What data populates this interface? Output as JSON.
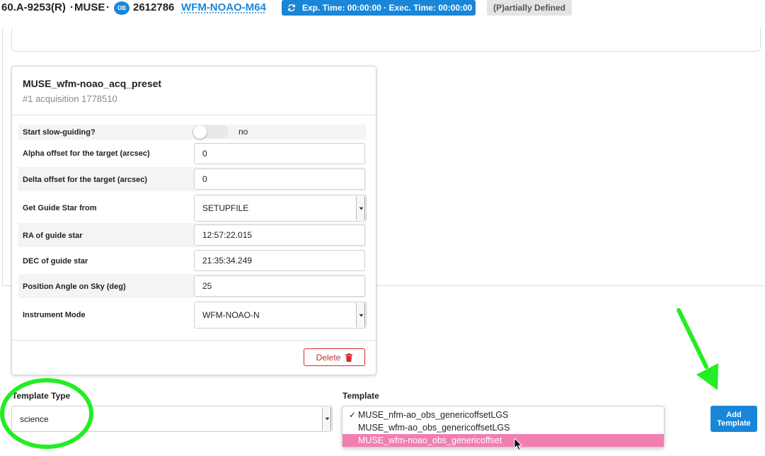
{
  "header": {
    "program": "60.A-9253(R)",
    "sep1": "·",
    "instrument": "MUSE",
    "sep2": "·",
    "ob_badge": "OB",
    "ob_id": "2612786",
    "ob_name": "WFM-NOAO-M64",
    "exposure_info": "Exp. Time: 00:00:00 · Exec. Time: 00:00:00",
    "status": "(P)artially Defined"
  },
  "template_card": {
    "title": "MUSE_wfm-noao_acq_preset",
    "subtitle": "#1 acquisition 1778510",
    "params": {
      "slow_guiding": {
        "label": "Start slow-guiding?",
        "value": "no",
        "enabled": false
      },
      "alpha_offset": {
        "label": "Alpha offset for the target (arcsec)",
        "value": "0"
      },
      "delta_offset": {
        "label": "Delta offset for the target (arcsec)",
        "value": "0"
      },
      "guide_star_from": {
        "label": "Get Guide Star from",
        "value": "SETUPFILE"
      },
      "ra_guide": {
        "label": "RA of guide star",
        "value": "12:57:22.015"
      },
      "dec_guide": {
        "label": "DEC of guide star",
        "value": "21:35:34.249"
      },
      "position_angle": {
        "label": "Position Angle on Sky (deg)",
        "value": "25"
      },
      "instrument_mode": {
        "label": "Instrument Mode",
        "value": "WFM-NOAO-N"
      }
    },
    "delete_label": "Delete"
  },
  "template_type": {
    "label": "Template Type",
    "value": "science"
  },
  "template": {
    "label": "Template",
    "options": [
      {
        "label": "MUSE_nfm-ao_obs_genericoffsetLGS",
        "checked": true,
        "highlighted": false
      },
      {
        "label": "MUSE_wfm-ao_obs_genericoffsetLGS",
        "checked": false,
        "highlighted": false
      },
      {
        "label": "MUSE_wfm-noao_obs_genericoffset",
        "checked": false,
        "highlighted": true
      }
    ],
    "check_mark": "✓"
  },
  "add_template": {
    "line1": "Add",
    "line2": "Template"
  },
  "colors": {
    "accent": "#1a86d8",
    "danger": "#d9262e",
    "highlight": "#f07fb0",
    "annotation": "#22ee22"
  },
  "icons": {
    "refresh": "refresh-icon",
    "trash": "trash-icon",
    "dropdown": "caret-down-icon",
    "cursor": "mouse-pointer-icon"
  }
}
